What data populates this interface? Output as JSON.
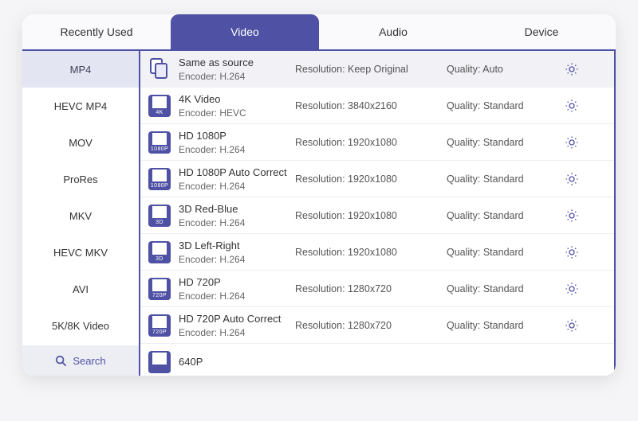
{
  "tabs": {
    "recently_used": "Recently Used",
    "video": "Video",
    "audio": "Audio",
    "device": "Device"
  },
  "sidebar": {
    "items": [
      {
        "label": "MP4"
      },
      {
        "label": "HEVC MP4"
      },
      {
        "label": "MOV"
      },
      {
        "label": "ProRes"
      },
      {
        "label": "MKV"
      },
      {
        "label": "HEVC MKV"
      },
      {
        "label": "AVI"
      },
      {
        "label": "5K/8K Video"
      }
    ],
    "search_label": "Search"
  },
  "headers": {
    "resolution_prefix": "Resolution: ",
    "quality_prefix": "Quality: ",
    "encoder_prefix": "Encoder: "
  },
  "presets": [
    {
      "title": "Same as source",
      "encoder": "H.264",
      "resolution": "Keep Original",
      "quality": "Auto",
      "badge": ""
    },
    {
      "title": "4K Video",
      "encoder": "HEVC",
      "resolution": "3840x2160",
      "quality": "Standard",
      "badge": "4K"
    },
    {
      "title": "HD 1080P",
      "encoder": "H.264",
      "resolution": "1920x1080",
      "quality": "Standard",
      "badge": "1080P"
    },
    {
      "title": "HD 1080P Auto Correct",
      "encoder": "H.264",
      "resolution": "1920x1080",
      "quality": "Standard",
      "badge": "1080P"
    },
    {
      "title": "3D Red-Blue",
      "encoder": "H.264",
      "resolution": "1920x1080",
      "quality": "Standard",
      "badge": "3D"
    },
    {
      "title": "3D Left-Right",
      "encoder": "H.264",
      "resolution": "1920x1080",
      "quality": "Standard",
      "badge": "3D"
    },
    {
      "title": "HD 720P",
      "encoder": "H.264",
      "resolution": "1280x720",
      "quality": "Standard",
      "badge": "720P"
    },
    {
      "title": "HD 720P Auto Correct",
      "encoder": "H.264",
      "resolution": "1280x720",
      "quality": "Standard",
      "badge": "720P"
    },
    {
      "title": "640P",
      "encoder": "",
      "resolution": "",
      "quality": "",
      "badge": ""
    }
  ]
}
